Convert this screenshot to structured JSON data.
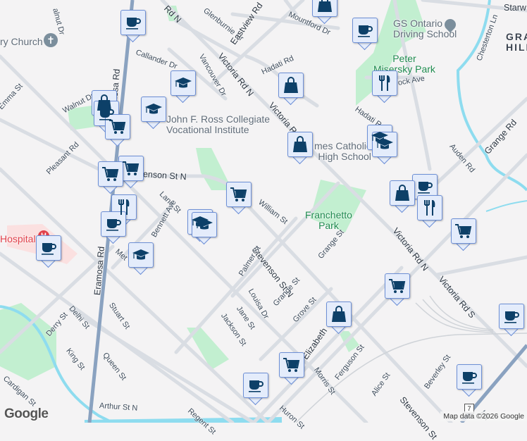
{
  "streets": {
    "glenburnie": "Glenburnie Dr",
    "eastview": "Eastview Rd",
    "mountford": "Mountford Dr",
    "starw": "Starw",
    "walnut_dr_top": "alnut Dr",
    "callander": "Callander Dr",
    "vancouver": "Vancouver Dr",
    "victoria_n1": "Victoria Rd N",
    "victoria_n2": "Victoria Rd N",
    "victoria_n3": "Victoria Rd N",
    "victoria_s": "Victoria Rd S",
    "victoria_top": "Rd N",
    "hadati1": "Hadati Rd",
    "hadati2": "Hadati Rd",
    "rock": "ock Ave",
    "chesterton": "Chesterton Ln",
    "auden": "Auden Rd",
    "grange_rd": "Grange Rd",
    "emma": "Emma St",
    "walnut": "Walnut Dr",
    "eramosa1": "Eramosa Rd",
    "eramosa2": "Eramosa Rd",
    "pleasant": "Pleasant Rd",
    "stevenson_top": "enson St N",
    "stevenson_mid": "Stevenson St N",
    "stevenson_bot": "Stevenson St",
    "lane": "Lane St",
    "william": "William St",
    "bennett": "Bennett Ave",
    "metcalfe": "Met",
    "palmer": "Palmer St",
    "louisa": "Louisa Dr",
    "jane": "Jane St",
    "jackson": "Jackson St",
    "grange1": "Grange St",
    "grange2": "Grange St",
    "grove": "Grove St",
    "elizabeth": "Elizabeth",
    "stuart": "Stuart St",
    "delhi": "Delhi St",
    "derry": "Derry St",
    "king": "King St",
    "queen": "Queen St",
    "cardigan": "Cardigan St",
    "arthur": "Arthur St N",
    "regent": "Regent St",
    "huron": "Huron St",
    "morris": "Morris St",
    "ferguson": "Ferguson St",
    "alice": "Alice St",
    "beverley": "Beverley St",
    "hav": "Ha",
    "route": "7"
  },
  "places": {
    "church": "ry Church",
    "driving_school": [
      "GS Ontario",
      "Driving School"
    ],
    "peter_park": [
      "Peter",
      "Misersky Park"
    ],
    "john_ross": [
      "John F. Ross Collegiate",
      "Vocational Institute"
    ],
    "st_james": [
      "mes Catholic",
      "High School"
    ],
    "franchetto": [
      "Franchetto",
      "Park"
    ],
    "hospital": "Hospital",
    "area": [
      "GRA",
      "HILL"
    ]
  },
  "markers": [
    {
      "type": "cafe"
    },
    {
      "type": "shopping"
    },
    {
      "type": "cafe"
    },
    {
      "type": "shopping"
    },
    {
      "type": "school"
    },
    {
      "type": "school"
    },
    {
      "type": "shopping"
    },
    {
      "type": "cafe"
    },
    {
      "type": "grocery"
    },
    {
      "type": "restaurant"
    },
    {
      "type": "shopping"
    },
    {
      "type": "school"
    },
    {
      "type": "school"
    },
    {
      "type": "grocery"
    },
    {
      "type": "grocery"
    },
    {
      "type": "grocery"
    },
    {
      "type": "restaurant"
    },
    {
      "type": "cafe"
    },
    {
      "type": "school"
    },
    {
      "type": "school"
    },
    {
      "type": "cafe"
    },
    {
      "type": "school"
    },
    {
      "type": "cafe"
    },
    {
      "type": "shopping"
    },
    {
      "type": "restaurant"
    },
    {
      "type": "grocery"
    },
    {
      "type": "grocery"
    },
    {
      "type": "shopping"
    },
    {
      "type": "cafe"
    },
    {
      "type": "grocery"
    },
    {
      "type": "cafe"
    },
    {
      "type": "cafe"
    }
  ],
  "branding": {
    "logo": "Google",
    "attribution": "Map data ©2026 Google"
  },
  "colors": {
    "marker_bg": "#e4ecfb",
    "marker_border": "#6d8fd6",
    "icon": "#0d4068",
    "road": "#d9dde3",
    "arterial": "#8aa2c0",
    "park": "#c2efd0",
    "water": "#8edcef"
  }
}
